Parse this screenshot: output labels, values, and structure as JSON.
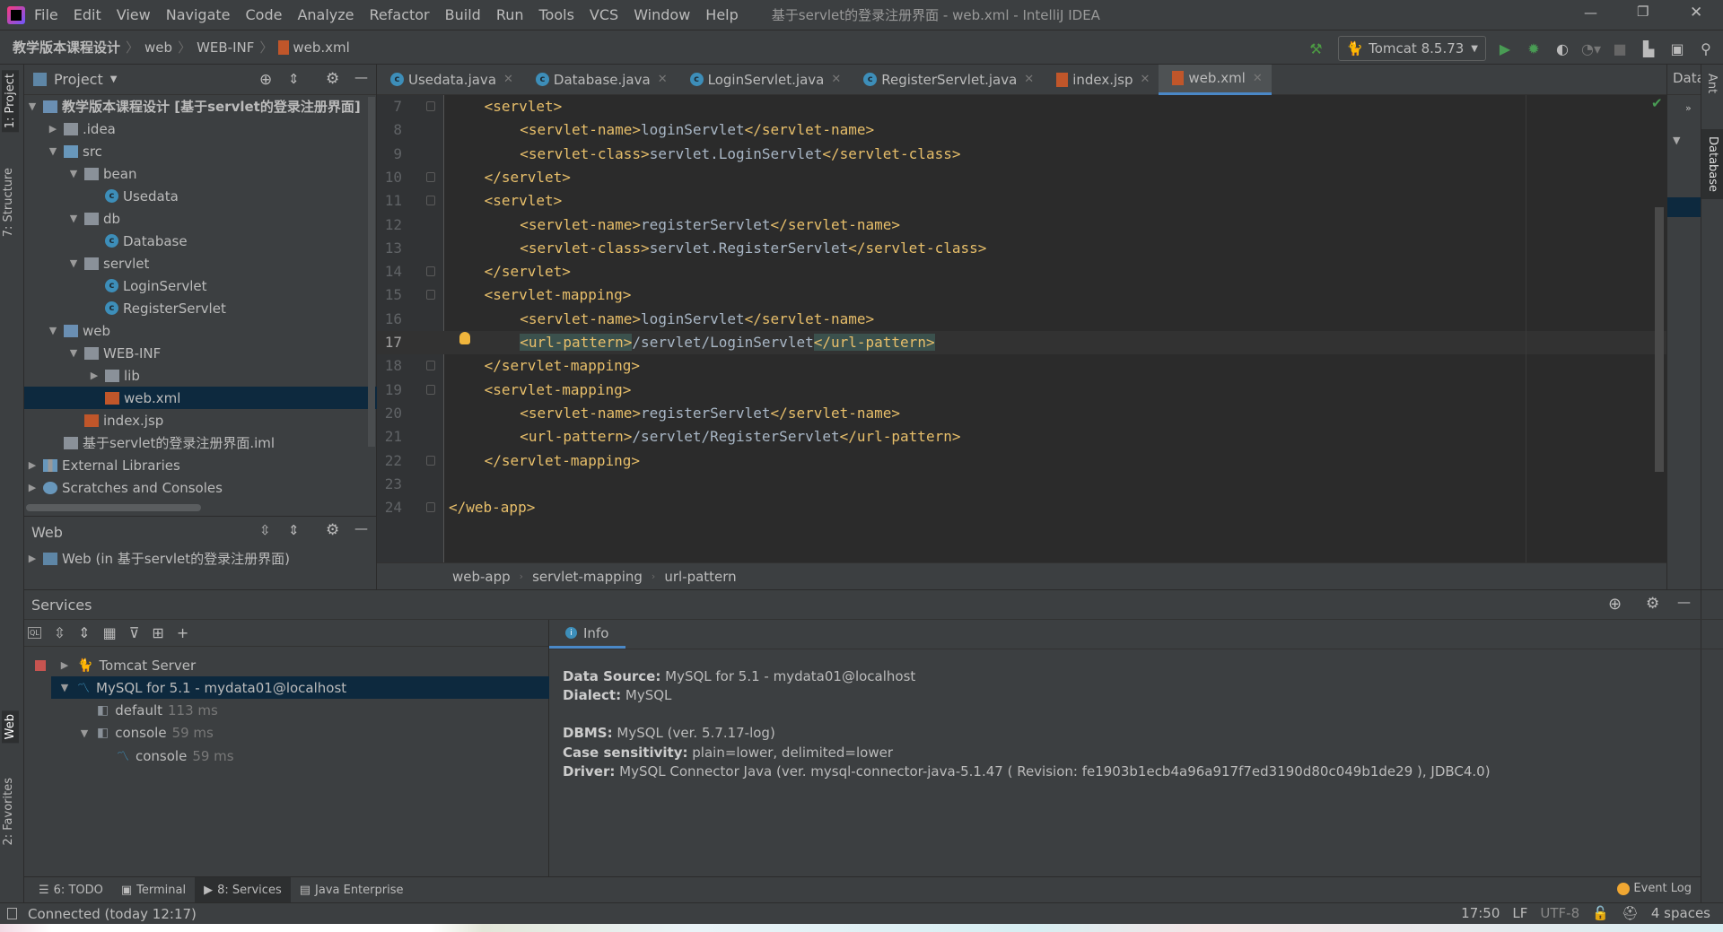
{
  "title_bar": {
    "menu": [
      "File",
      "Edit",
      "View",
      "Navigate",
      "Code",
      "Analyze",
      "Refactor",
      "Build",
      "Run",
      "Tools",
      "VCS",
      "Window",
      "Help"
    ],
    "window_title": "基于servlet的登录注册界面 - web.xml - IntelliJ IDEA"
  },
  "nav": {
    "breadcrumb": [
      "教学版本课程设计",
      "web",
      "WEB-INF",
      "web.xml"
    ],
    "run_config": "Tomcat 8.5.73"
  },
  "left_strip": {
    "tabs": [
      "1: Project",
      "7: Structure",
      "Web",
      "2: Favorites"
    ]
  },
  "project": {
    "title": "Project",
    "tree": [
      {
        "label": "教学版本课程设计 [基于servlet的登录注册界面]",
        "depth": 0,
        "arrow": "down",
        "icon": "module",
        "bold": true
      },
      {
        "label": ".idea",
        "depth": 1,
        "arrow": "right",
        "icon": "folder"
      },
      {
        "label": "src",
        "depth": 1,
        "arrow": "down",
        "icon": "folder-blue"
      },
      {
        "label": "bean",
        "depth": 2,
        "arrow": "down",
        "icon": "package"
      },
      {
        "label": "Usedata",
        "depth": 3,
        "icon": "class"
      },
      {
        "label": "db",
        "depth": 2,
        "arrow": "down",
        "icon": "package"
      },
      {
        "label": "Database",
        "depth": 3,
        "icon": "class"
      },
      {
        "label": "servlet",
        "depth": 2,
        "arrow": "down",
        "icon": "package"
      },
      {
        "label": "LoginServlet",
        "depth": 3,
        "icon": "class"
      },
      {
        "label": "RegisterServlet",
        "depth": 3,
        "icon": "class"
      },
      {
        "label": "web",
        "depth": 1,
        "arrow": "down",
        "icon": "folder-web"
      },
      {
        "label": "WEB-INF",
        "depth": 2,
        "arrow": "down",
        "icon": "folder"
      },
      {
        "label": "lib",
        "depth": 3,
        "arrow": "right",
        "icon": "folder"
      },
      {
        "label": "web.xml",
        "depth": 3,
        "icon": "xml",
        "selected": true
      },
      {
        "label": "index.jsp",
        "depth": 2,
        "icon": "jsp"
      },
      {
        "label": "基于servlet的登录注册界面.iml",
        "depth": 1,
        "icon": "iml"
      },
      {
        "label": "External Libraries",
        "depth": 0,
        "arrow": "right",
        "icon": "libraries"
      },
      {
        "label": "Scratches and Consoles",
        "depth": 0,
        "arrow": "right",
        "icon": "scratches"
      }
    ]
  },
  "web_panel": {
    "title": "Web",
    "item": "Web (in 基于servlet的登录注册界面)"
  },
  "editor": {
    "tabs": [
      {
        "label": "Usedata.java",
        "icon": "class"
      },
      {
        "label": "Database.java",
        "icon": "class"
      },
      {
        "label": "LoginServlet.java",
        "icon": "class"
      },
      {
        "label": "RegisterServlet.java",
        "icon": "class"
      },
      {
        "label": "index.jsp",
        "icon": "jsp"
      },
      {
        "label": "web.xml",
        "icon": "xml",
        "active": true
      }
    ],
    "current_line": 17,
    "lines": [
      {
        "n": "7",
        "indent": 1,
        "parts": [
          [
            "tag",
            "<servlet>"
          ]
        ]
      },
      {
        "n": "8",
        "indent": 2,
        "parts": [
          [
            "tag",
            "<servlet-name>"
          ],
          [
            "txt",
            "loginServlet"
          ],
          [
            "tag",
            "</servlet-name>"
          ]
        ]
      },
      {
        "n": "9",
        "indent": 2,
        "parts": [
          [
            "tag",
            "<servlet-class>"
          ],
          [
            "txt",
            "servlet.LoginServlet"
          ],
          [
            "tag",
            "</servlet-class>"
          ]
        ]
      },
      {
        "n": "10",
        "indent": 1,
        "parts": [
          [
            "tag",
            "</servlet>"
          ]
        ]
      },
      {
        "n": "11",
        "indent": 1,
        "parts": [
          [
            "tag",
            "<servlet>"
          ]
        ]
      },
      {
        "n": "12",
        "indent": 2,
        "parts": [
          [
            "tag",
            "<servlet-name>"
          ],
          [
            "txt",
            "registerServlet"
          ],
          [
            "tag",
            "</servlet-name>"
          ]
        ]
      },
      {
        "n": "13",
        "indent": 2,
        "parts": [
          [
            "tag",
            "<servlet-class>"
          ],
          [
            "txt",
            "servlet.RegisterServlet"
          ],
          [
            "tag",
            "</servlet-class>"
          ]
        ]
      },
      {
        "n": "14",
        "indent": 1,
        "parts": [
          [
            "tag",
            "</servlet>"
          ]
        ]
      },
      {
        "n": "15",
        "indent": 1,
        "parts": [
          [
            "tag",
            "<servlet-mapping>"
          ]
        ]
      },
      {
        "n": "16",
        "indent": 2,
        "parts": [
          [
            "tag",
            "<servlet-name>"
          ],
          [
            "txt",
            "loginServlet"
          ],
          [
            "tag",
            "</servlet-name>"
          ]
        ]
      },
      {
        "n": "17",
        "indent": 2,
        "parts": [
          [
            "tag hl",
            "<url-pattern>"
          ],
          [
            "txt",
            "/servlet/LoginServlet"
          ],
          [
            "tag hl",
            "</url-pattern>"
          ]
        ]
      },
      {
        "n": "18",
        "indent": 1,
        "parts": [
          [
            "tag",
            "</servlet-mapping>"
          ]
        ]
      },
      {
        "n": "19",
        "indent": 1,
        "parts": [
          [
            "tag",
            "<servlet-mapping>"
          ]
        ]
      },
      {
        "n": "20",
        "indent": 2,
        "parts": [
          [
            "tag",
            "<servlet-name>"
          ],
          [
            "txt",
            "registerServlet"
          ],
          [
            "tag",
            "</servlet-name>"
          ]
        ]
      },
      {
        "n": "21",
        "indent": 2,
        "parts": [
          [
            "tag",
            "<url-pattern>"
          ],
          [
            "txt",
            "/servlet/RegisterServlet"
          ],
          [
            "tag",
            "</url-pattern>"
          ]
        ]
      },
      {
        "n": "22",
        "indent": 1,
        "parts": [
          [
            "tag",
            "</servlet-mapping>"
          ]
        ]
      },
      {
        "n": "23",
        "indent": 0,
        "parts": []
      },
      {
        "n": "24",
        "indent": 0,
        "parts": [
          [
            "tag",
            "</web-app>"
          ]
        ]
      }
    ],
    "breadcrumb": [
      "web-app",
      "servlet-mapping",
      "url-pattern"
    ]
  },
  "right": {
    "panel_title": "Data",
    "strip_tabs": [
      "Ant",
      "Database"
    ]
  },
  "services": {
    "title": "Services",
    "tree": [
      {
        "label": "Tomcat Server",
        "arrow": "right",
        "icon": "tomcat",
        "depth": 0
      },
      {
        "label": "MySQL for 5.1 - mydata01@localhost",
        "arrow": "down",
        "icon": "mysql",
        "depth": 0,
        "selected": true
      },
      {
        "label": "default",
        "time": "113 ms",
        "icon": "session",
        "depth": 1
      },
      {
        "label": "console",
        "time": "59 ms",
        "icon": "session",
        "arrow": "down",
        "depth": 1
      },
      {
        "label": "console",
        "time": "59 ms",
        "icon": "mysql",
        "depth": 2
      }
    ],
    "info_tab": "Info",
    "info": [
      {
        "k": "Data Source:",
        "v": "MySQL for 5.1 - mydata01@localhost"
      },
      {
        "k": "Dialect:",
        "v": "MySQL"
      },
      {
        "k": "DBMS:",
        "v": "MySQL (ver. 5.7.17-log)"
      },
      {
        "k": "Case sensitivity:",
        "v": "plain=lower, delimited=lower"
      },
      {
        "k": "Driver:",
        "v": "MySQL Connector Java (ver. mysql-connector-java-5.1.47 ( Revision: fe1903b1ecb4a96a917f7ed3190d80c049b1de29 ), JDBC4.0)"
      }
    ]
  },
  "bottom_tabs": [
    {
      "label": "6: TODO"
    },
    {
      "label": "Terminal"
    },
    {
      "label": "8: Services",
      "active": true
    },
    {
      "label": "Java Enterprise"
    }
  ],
  "event_log": "Event Log",
  "status": {
    "message": "Connected (today 12:17)",
    "position": "17:50",
    "line_sep": "LF",
    "encoding": "UTF-8",
    "indent": "4 spaces"
  },
  "colors": {
    "tag": "#e8bf6a",
    "text": "#a9b7c6",
    "selection": "#0d293e",
    "accent": "#4a88c7"
  }
}
